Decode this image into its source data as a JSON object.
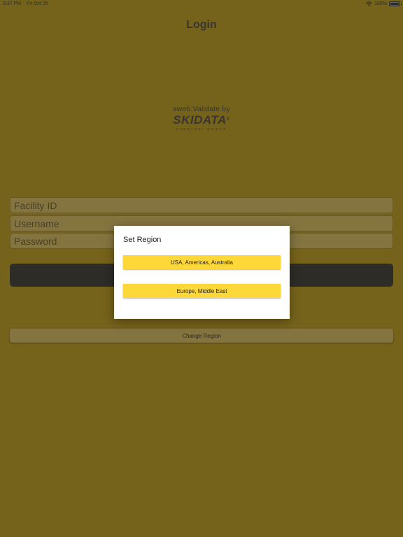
{
  "status_bar": {
    "time": "3:37 PM",
    "date": "Fri Oct 25",
    "battery": "100%",
    "icons": [
      "wifi-icon",
      "battery-icon"
    ]
  },
  "nav": {
    "title": "Login"
  },
  "brand": {
    "tagline": "sweb.Validate by",
    "logo_text": "SKIDATA",
    "logo_mark": "®",
    "logo_subtext": "KUDELSKI GROUP"
  },
  "form": {
    "facility_placeholder": "Facility ID",
    "username_placeholder": "Username",
    "password_placeholder": "Password",
    "login_label": "",
    "change_region_label": "Change Region"
  },
  "dialog": {
    "title": "Set Region",
    "options": [
      "USA, Americas, Australia",
      "Europe, Middle East"
    ]
  },
  "colors": {
    "background_dimmed": "#75631b",
    "accent_yellow": "#fed738",
    "button_dark": "#2e2c27",
    "dialog_bg": "#ffffff"
  }
}
